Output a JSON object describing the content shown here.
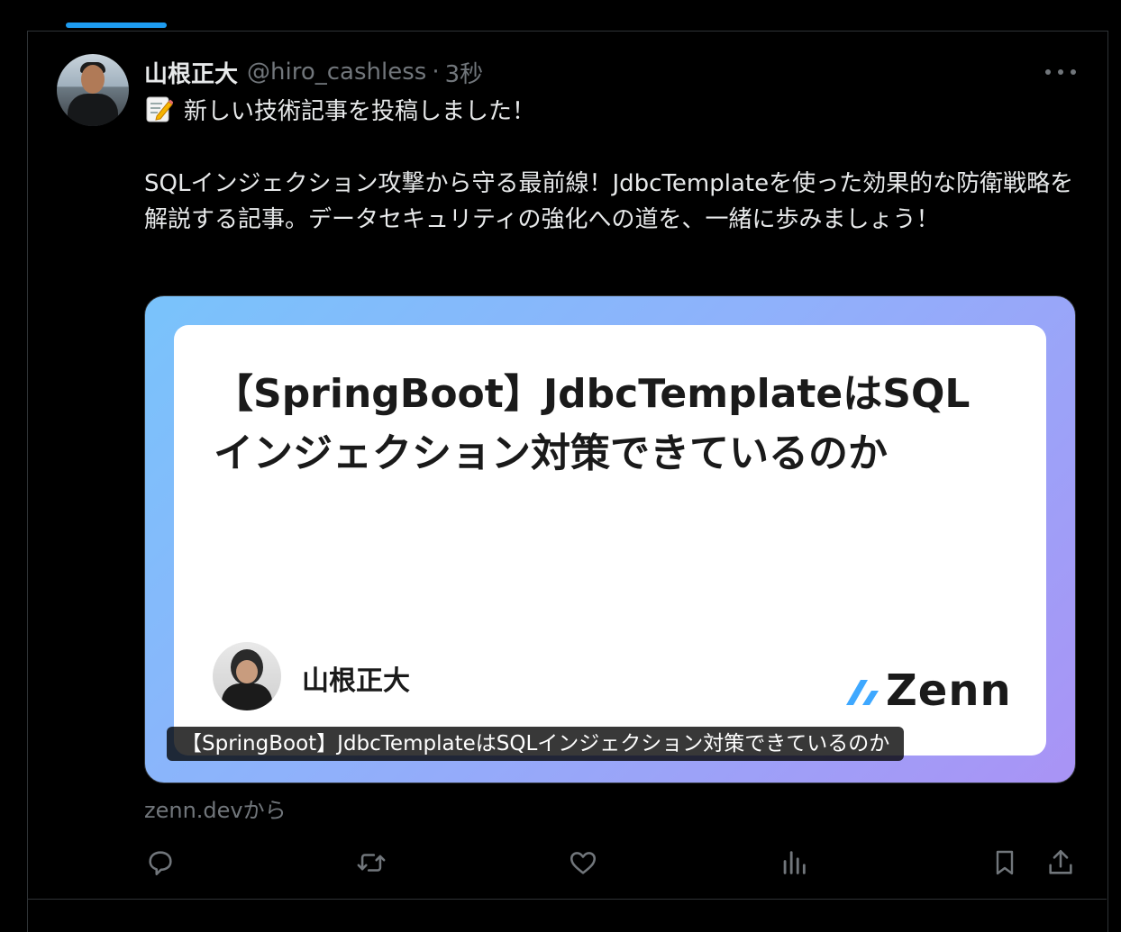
{
  "post": {
    "display_name": "山根正大",
    "handle": "@hiro_cashless",
    "separator": "·",
    "timestamp": "3秒",
    "text_line1": "新しい技術記事を投稿しました！",
    "text_paragraph": "SQLインジェクション攻撃から守る最前線！JdbcTemplateを使った効果的な防衛戦略を解説する記事。データセキュリティの強化への道を、一緒に歩みましょう！"
  },
  "card": {
    "title": "【SpringBoot】JdbcTemplateはSQLインジェクション対策できているのか",
    "author": "山根正大",
    "brand": "Zenn",
    "caption": "【SpringBoot】JdbcTemplateはSQLインジェクション対策できているのか"
  },
  "source": "zenn.devから",
  "icons": [
    "memo-icon",
    "more-icon",
    "reply-icon",
    "retweet-icon",
    "like-icon",
    "views-icon",
    "bookmark-icon",
    "share-icon",
    "zenn-logo-icon"
  ],
  "colors": {
    "background": "#000000",
    "text": "#e7e9ea",
    "secondary": "#71767b",
    "accent": "#1d9bf0",
    "zenn_blue": "#3ea8ff"
  }
}
